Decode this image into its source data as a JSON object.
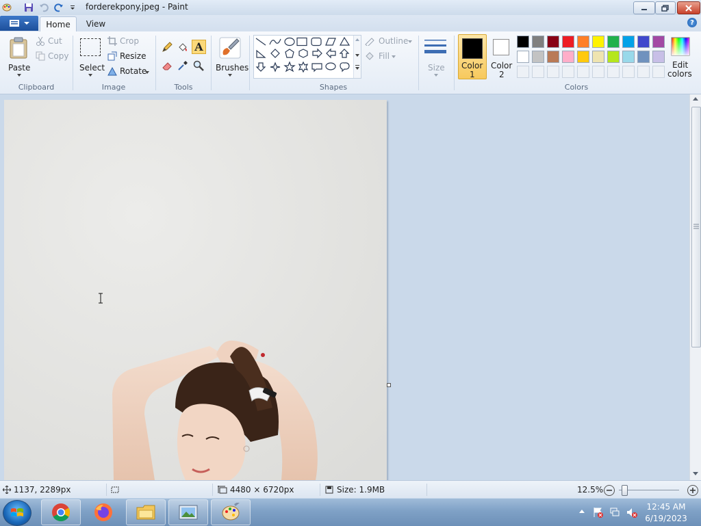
{
  "window": {
    "title": "forderekpony.jpeg - Paint"
  },
  "tabs": [
    "Home",
    "View"
  ],
  "clipboard": {
    "paste": "Paste",
    "cut": "Cut",
    "copy": "Copy",
    "group": "Clipboard"
  },
  "image": {
    "select": "Select",
    "crop": "Crop",
    "resize": "Resize",
    "rotate": "Rotate",
    "group": "Image"
  },
  "tools": {
    "group": "Tools",
    "brushes": "Brushes"
  },
  "shapes": {
    "outline": "Outline",
    "fill": "Fill",
    "group": "Shapes"
  },
  "size": {
    "label": "Size"
  },
  "colors": {
    "color1_line1": "Color",
    "color1_line2": "1",
    "color2_line1": "Color",
    "color2_line2": "2",
    "edit_line1": "Edit",
    "edit_line2": "colors",
    "group": "Colors",
    "color1": "#000000",
    "color2": "#ffffff",
    "palette_row1": [
      "#000000",
      "#7f7f7f",
      "#880015",
      "#ed1c24",
      "#ff7f27",
      "#fff200",
      "#22b14c",
      "#00a2e8",
      "#3f48cc",
      "#a349a4"
    ],
    "palette_row2": [
      "#ffffff",
      "#c3c3c3",
      "#b97a57",
      "#ffaec9",
      "#ffc90e",
      "#efe4b0",
      "#b5e61d",
      "#99d9ea",
      "#7092be",
      "#c8bfe7"
    ]
  },
  "status": {
    "cursor_pos": "1137, 2289px",
    "dimensions": "4480 × 6720px",
    "size": "Size: 1.9MB",
    "zoom": "12.5%"
  },
  "taskbar": {
    "time": "12:45 AM",
    "date": "6/19/2023"
  }
}
